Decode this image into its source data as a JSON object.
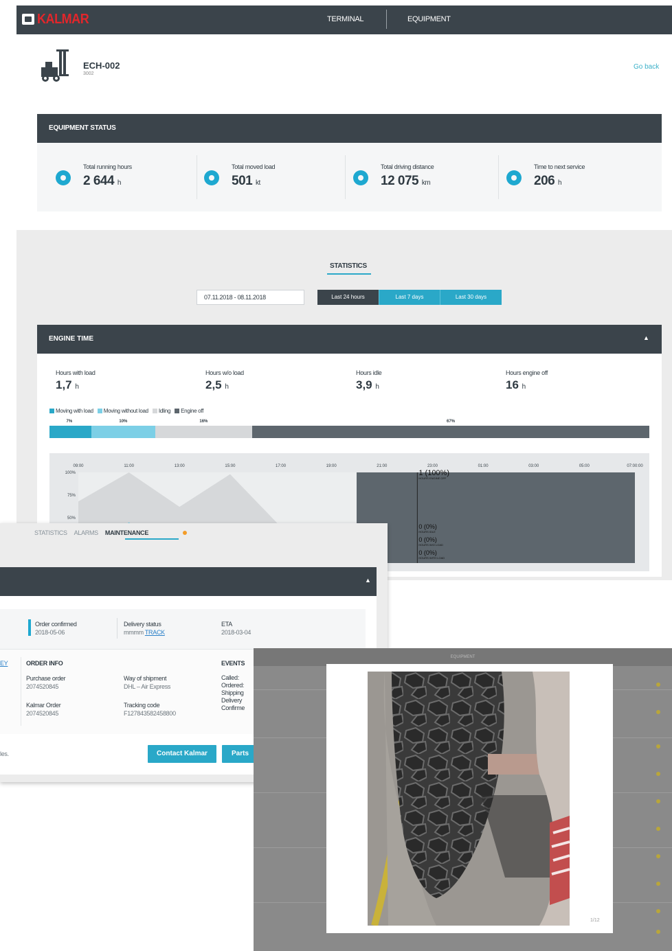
{
  "header": {
    "logo": "KALMAR",
    "nav": [
      "TERMINAL",
      "EQUIPMENT"
    ]
  },
  "equipment": {
    "title": "ECH-002",
    "subtitle": "3002",
    "go_back": "Go back"
  },
  "equipment_status": {
    "title": "EQUIPMENT STATUS",
    "kpis": [
      {
        "label": "Total running hours",
        "value": "2 644",
        "unit": "h",
        "icon": "clock-icon"
      },
      {
        "label": "Total moved load",
        "value": "501",
        "unit": "kt",
        "icon": "weight-icon"
      },
      {
        "label": "Total driving distance",
        "value": "12 075",
        "unit": "km",
        "icon": "speedometer-icon"
      },
      {
        "label": "Time to next service",
        "value": "206",
        "unit": "h",
        "icon": "gear-icon"
      }
    ]
  },
  "statistics": {
    "tab": "STATISTICS",
    "date_range": "07.11.2018 - 08.11.2018",
    "ranges": [
      "Last 24 hours",
      "Last 7 days",
      "Last 30 days"
    ],
    "active_range": "Last 24 hours"
  },
  "engine_time": {
    "title": "ENGINE TIME",
    "hours": [
      {
        "label": "Hours with load",
        "value": "1,7",
        "unit": "h"
      },
      {
        "label": "Hours w/o load",
        "value": "2,5",
        "unit": "h"
      },
      {
        "label": "Hours idle",
        "value": "3,9",
        "unit": "h"
      },
      {
        "label": "Hours engine off",
        "value": "16",
        "unit": "h"
      }
    ],
    "legend": [
      {
        "label": "Moving with load",
        "color": "#2aa8c8"
      },
      {
        "label": "Moving without load",
        "color": "#7ccfe6"
      },
      {
        "label": "Idling",
        "color": "#d6d8da"
      },
      {
        "label": "Engine off",
        "color": "#5d666d"
      }
    ],
    "shares": [
      {
        "label": "7%",
        "fraction": 0.07,
        "color": "#2aa8c8"
      },
      {
        "label": "10%",
        "fraction": 0.106,
        "color": "#7ccfe6"
      },
      {
        "label": "16%",
        "fraction": 0.162,
        "color": "#d6d8da"
      },
      {
        "label": "67%",
        "fraction": 0.662,
        "color": "#5d666d"
      }
    ]
  },
  "chart_data": {
    "type": "area",
    "title": "",
    "xlabel": "",
    "ylabel": "",
    "x": [
      "09:00",
      "11:00",
      "13:00",
      "15:00",
      "17:00",
      "19:00",
      "21:00",
      "23:00",
      "01:00",
      "03:00",
      "05:00",
      "07:00:00"
    ],
    "y_ticks": [
      "100%",
      "75%",
      "50%"
    ],
    "ylim": [
      0,
      100
    ],
    "series": [
      {
        "name": "Engine off",
        "color": "#5d666d",
        "values": [
          0,
          0,
          0,
          0,
          0,
          0,
          100,
          100,
          100,
          100,
          100,
          100
        ]
      },
      {
        "name": "Idling",
        "color": "#d6d8da",
        "values": [
          68,
          100,
          62,
          98,
          40,
          0,
          0,
          0,
          0,
          0,
          0,
          0
        ]
      },
      {
        "name": "Moving without load",
        "color": "#7ccfe6",
        "values": [
          0,
          45,
          0,
          40,
          0,
          0,
          0,
          0,
          0,
          0,
          0,
          0
        ]
      }
    ],
    "tooltip": [
      {
        "value": "1 (100%)",
        "label": "HOURS ENGINE OFF"
      },
      {
        "value": "0 (0%)",
        "label": "HOURS IDLE"
      },
      {
        "value": "0 (0%)",
        "label": "HOURS W/O LOAD"
      },
      {
        "value": "0 (0%)",
        "label": "HOURS WITH LOAD"
      }
    ]
  },
  "maintenance": {
    "tabs": [
      "STATISTICS",
      "ALARMS",
      "MAINTENANCE"
    ],
    "active_tab": "MAINTENANCE",
    "status": {
      "order_label": "Order confirmed",
      "order_date": "2018-05-06",
      "delivery_label": "Delivery status",
      "delivery_value": "mmmm",
      "track": "TRACK",
      "eta_label": "ETA",
      "eta_date": "2018-03-04"
    },
    "order_info": {
      "title": "ORDER INFO",
      "purchase_label": "Purchase order",
      "purchase_value": "2074520845",
      "kalmar_label": "Kalmar Order",
      "kalmar_value": "2074520845",
      "shipment_label": "Way of shipment",
      "shipment_value": "DHL – Air Express",
      "tracking_label": "Tracking code",
      "tracking_value": "F127843582458800"
    },
    "events": {
      "title": "EVENTS",
      "items": [
        "Called:",
        "Ordered:",
        "Shipping",
        "Delivery",
        "Confirme"
      ]
    },
    "left_link": "EY",
    "left_text": "les.",
    "contact_button": "Contact Kalmar",
    "parts_button": "Parts"
  },
  "photo_overlay": {
    "header": "EQUIPMENT",
    "counter": "1/12"
  }
}
